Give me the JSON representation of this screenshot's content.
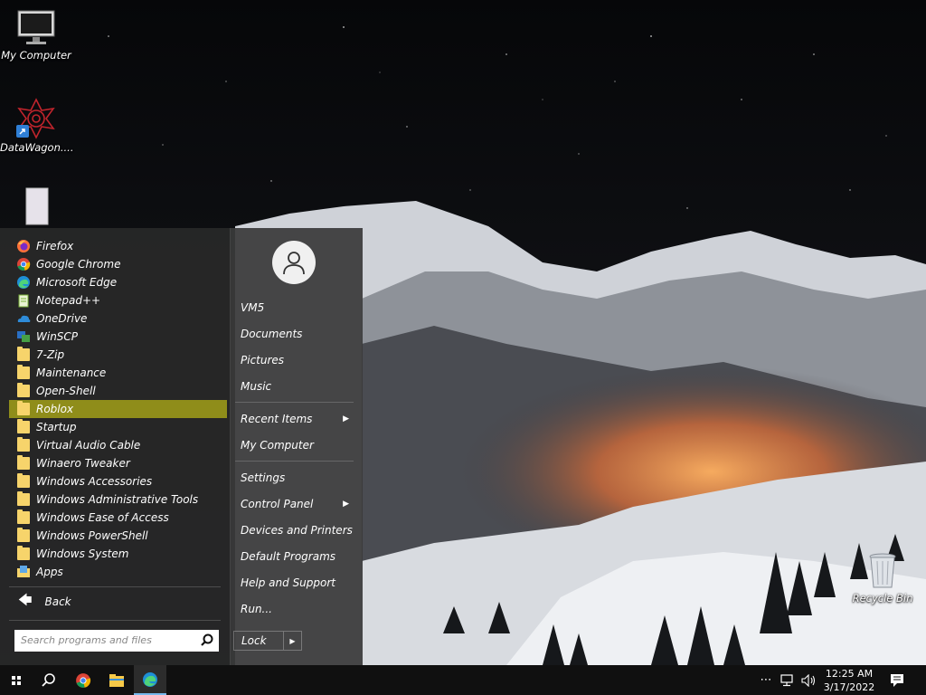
{
  "desktop": {
    "icons": [
      {
        "label": "My Computer"
      },
      {
        "label": "DataWagon...."
      },
      {
        "label": ""
      },
      {
        "label": "Recycle Bin"
      }
    ]
  },
  "start_menu": {
    "programs": [
      {
        "label": "Firefox",
        "icon": "firefox-icon"
      },
      {
        "label": "Google Chrome",
        "icon": "chrome-icon"
      },
      {
        "label": "Microsoft Edge",
        "icon": "edge-icon"
      },
      {
        "label": "Notepad++",
        "icon": "notepadpp-icon"
      },
      {
        "label": "OneDrive",
        "icon": "onedrive-icon"
      },
      {
        "label": "WinSCP",
        "icon": "winscp-icon"
      },
      {
        "label": "7-Zip",
        "icon": "folder-icon"
      },
      {
        "label": "Maintenance",
        "icon": "folder-icon"
      },
      {
        "label": "Open-Shell",
        "icon": "folder-icon"
      },
      {
        "label": "Roblox",
        "icon": "folder-icon",
        "selected": true
      },
      {
        "label": "Startup",
        "icon": "folder-icon"
      },
      {
        "label": "Virtual Audio Cable",
        "icon": "folder-icon"
      },
      {
        "label": "Winaero Tweaker",
        "icon": "folder-icon"
      },
      {
        "label": "Windows Accessories",
        "icon": "folder-icon"
      },
      {
        "label": "Windows Administrative Tools",
        "icon": "folder-icon"
      },
      {
        "label": "Windows Ease of Access",
        "icon": "folder-icon"
      },
      {
        "label": "Windows PowerShell",
        "icon": "folder-icon"
      },
      {
        "label": "Windows System",
        "icon": "folder-icon"
      },
      {
        "label": "Apps",
        "icon": "apps-folder-icon"
      }
    ],
    "back_label": "Back",
    "search_placeholder": "Search programs and files",
    "places": [
      {
        "label": "VM5"
      },
      {
        "label": "Documents"
      },
      {
        "label": "Pictures"
      },
      {
        "label": "Music"
      },
      {
        "label": "Recent Items",
        "submenu": true
      },
      {
        "label": "My Computer"
      },
      {
        "label": "Settings"
      },
      {
        "label": "Control Panel",
        "submenu": true
      },
      {
        "label": "Devices and Printers"
      },
      {
        "label": "Default Programs"
      },
      {
        "label": "Help and Support"
      },
      {
        "label": "Run..."
      }
    ],
    "lock_label": "Lock",
    "selected_color": "#8f8d1a"
  },
  "taskbar": {
    "time": "12:25 AM",
    "date": "3/17/2022",
    "pinned": [
      "start-icon",
      "search-icon",
      "chrome-icon",
      "file-explorer-icon",
      "edge-icon"
    ],
    "tray": [
      "overflow-icon",
      "network-icon",
      "volume-icon",
      "notification-icon"
    ]
  }
}
